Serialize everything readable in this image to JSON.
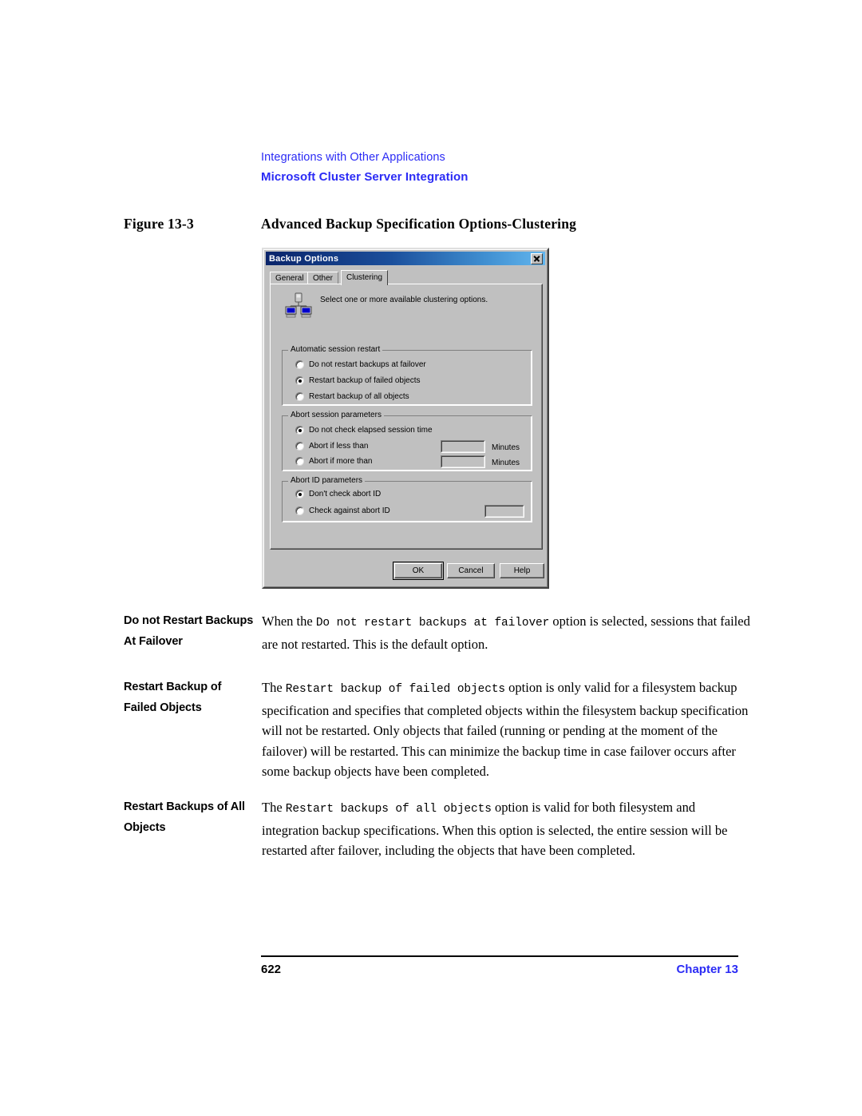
{
  "header": {
    "section": "Integrations with Other Applications",
    "subsection": "Microsoft Cluster Server Integration"
  },
  "figure": {
    "label": "Figure 13-3",
    "title": "Advanced Backup Specification Options-Clustering"
  },
  "dialog": {
    "title": "Backup Options",
    "close_label": "Close",
    "tabs": [
      {
        "label": "General",
        "active": false
      },
      {
        "label": "Other",
        "active": false
      },
      {
        "label": "Clustering",
        "active": true
      }
    ],
    "banner_text": "Select one or more available clustering options.",
    "icon_name": "cluster-icon",
    "groups": [
      {
        "title": "Automatic session restart",
        "options": [
          {
            "label": "Do not restart backups at failover",
            "checked": false
          },
          {
            "label": "Restart backup of failed objects",
            "checked": true
          },
          {
            "label": "Restart backup of all objects",
            "checked": false
          }
        ]
      },
      {
        "title": "Abort session parameters",
        "options": [
          {
            "label": "Do not check elapsed session time",
            "checked": true
          },
          {
            "label": "Abort if less than",
            "checked": false,
            "value": "",
            "unit": "Minutes"
          },
          {
            "label": "Abort if more than",
            "checked": false,
            "value": "",
            "unit": "Minutes"
          }
        ]
      },
      {
        "title": "Abort ID parameters",
        "options": [
          {
            "label": "Don't check abort ID",
            "checked": true
          },
          {
            "label": "Check against abort ID",
            "checked": false,
            "value": ""
          }
        ]
      }
    ],
    "buttons": {
      "ok": "OK",
      "cancel": "Cancel",
      "help": "Help"
    },
    "colors": {
      "face": "#c0c0c0",
      "titlebar_start": "#0a246a",
      "titlebar_end": "#62b6ee"
    }
  },
  "paragraphs": [
    {
      "term": "Do not Restart Backups At Failover",
      "text_before": "When the ",
      "mono": "Do not restart backups at failover",
      "text_after": " option is selected, sessions that failed are not restarted. This is the default option."
    },
    {
      "term": "Restart Backup of Failed Objects",
      "text_before": "The ",
      "mono": "Restart backup of failed objects",
      "text_after": " option is only valid for a filesystem backup specification and specifies that completed objects within the filesystem backup specification will not be restarted. Only objects that failed (running or pending at the moment of the failover) will be restarted. This can minimize the backup time in case failover occurs after some backup objects have been completed."
    },
    {
      "term": "Restart Backups of All Objects",
      "text_before": "The ",
      "mono": "Restart backups of all objects",
      "text_after": " option is valid for both filesystem and integration backup specifications. When this option is selected, the entire session will be restarted after failover, including the objects that have been completed."
    }
  ],
  "footer": {
    "page_number": "622",
    "chapter": "Chapter 13",
    "accent_color": "#2b2bf5"
  }
}
